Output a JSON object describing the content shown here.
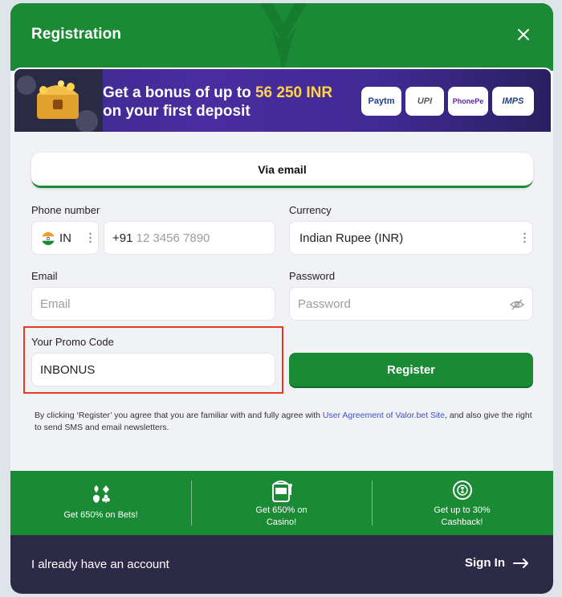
{
  "header": {
    "title": "Registration"
  },
  "banner": {
    "line1_prefix": "Get a bonus of up to ",
    "line1_amount": "56 250 INR",
    "line2": "on your first deposit",
    "payments": [
      "Paytm",
      "UPI",
      "PhonePe",
      "IMPS"
    ]
  },
  "tabs": {
    "active": "Via email"
  },
  "phone": {
    "label": "Phone number",
    "country_code": "IN",
    "prefix": "+91",
    "placeholder": "12 3456 7890"
  },
  "currency": {
    "label": "Currency",
    "value": "Indian Rupee (INR)"
  },
  "email": {
    "label": "Email",
    "placeholder": "Email"
  },
  "password": {
    "label": "Password",
    "placeholder": "Password"
  },
  "promo": {
    "label": "Your Promo Code",
    "value": "INBONUS"
  },
  "register_label": "Register",
  "terms": {
    "text_before": "By clicking ‘Register’ you agree that you are familiar with and fully agree with ",
    "link": "User Agreement of Valor.bet Site",
    "text_after": ", and also give the right to send SMS and email newsletters."
  },
  "bonuses": [
    {
      "icon": "card-suits-icon",
      "line1": "Get 650% on Bets!",
      "line2": ""
    },
    {
      "icon": "slot-machine-icon",
      "line1": "Get 650% on",
      "line2": "Casino!"
    },
    {
      "icon": "cashback-coin-icon",
      "line1": "Get up to 30%",
      "line2": "Cashback!"
    }
  ],
  "footer": {
    "have_account": "I already have an account",
    "sign_in": "Sign In"
  },
  "colors": {
    "brand_green": "#1a8a34",
    "promo_highlight": "#e23a1a",
    "footer_bg": "#2c2a47",
    "link": "#3d52c7",
    "bonus_amount": "#ffd34a"
  }
}
